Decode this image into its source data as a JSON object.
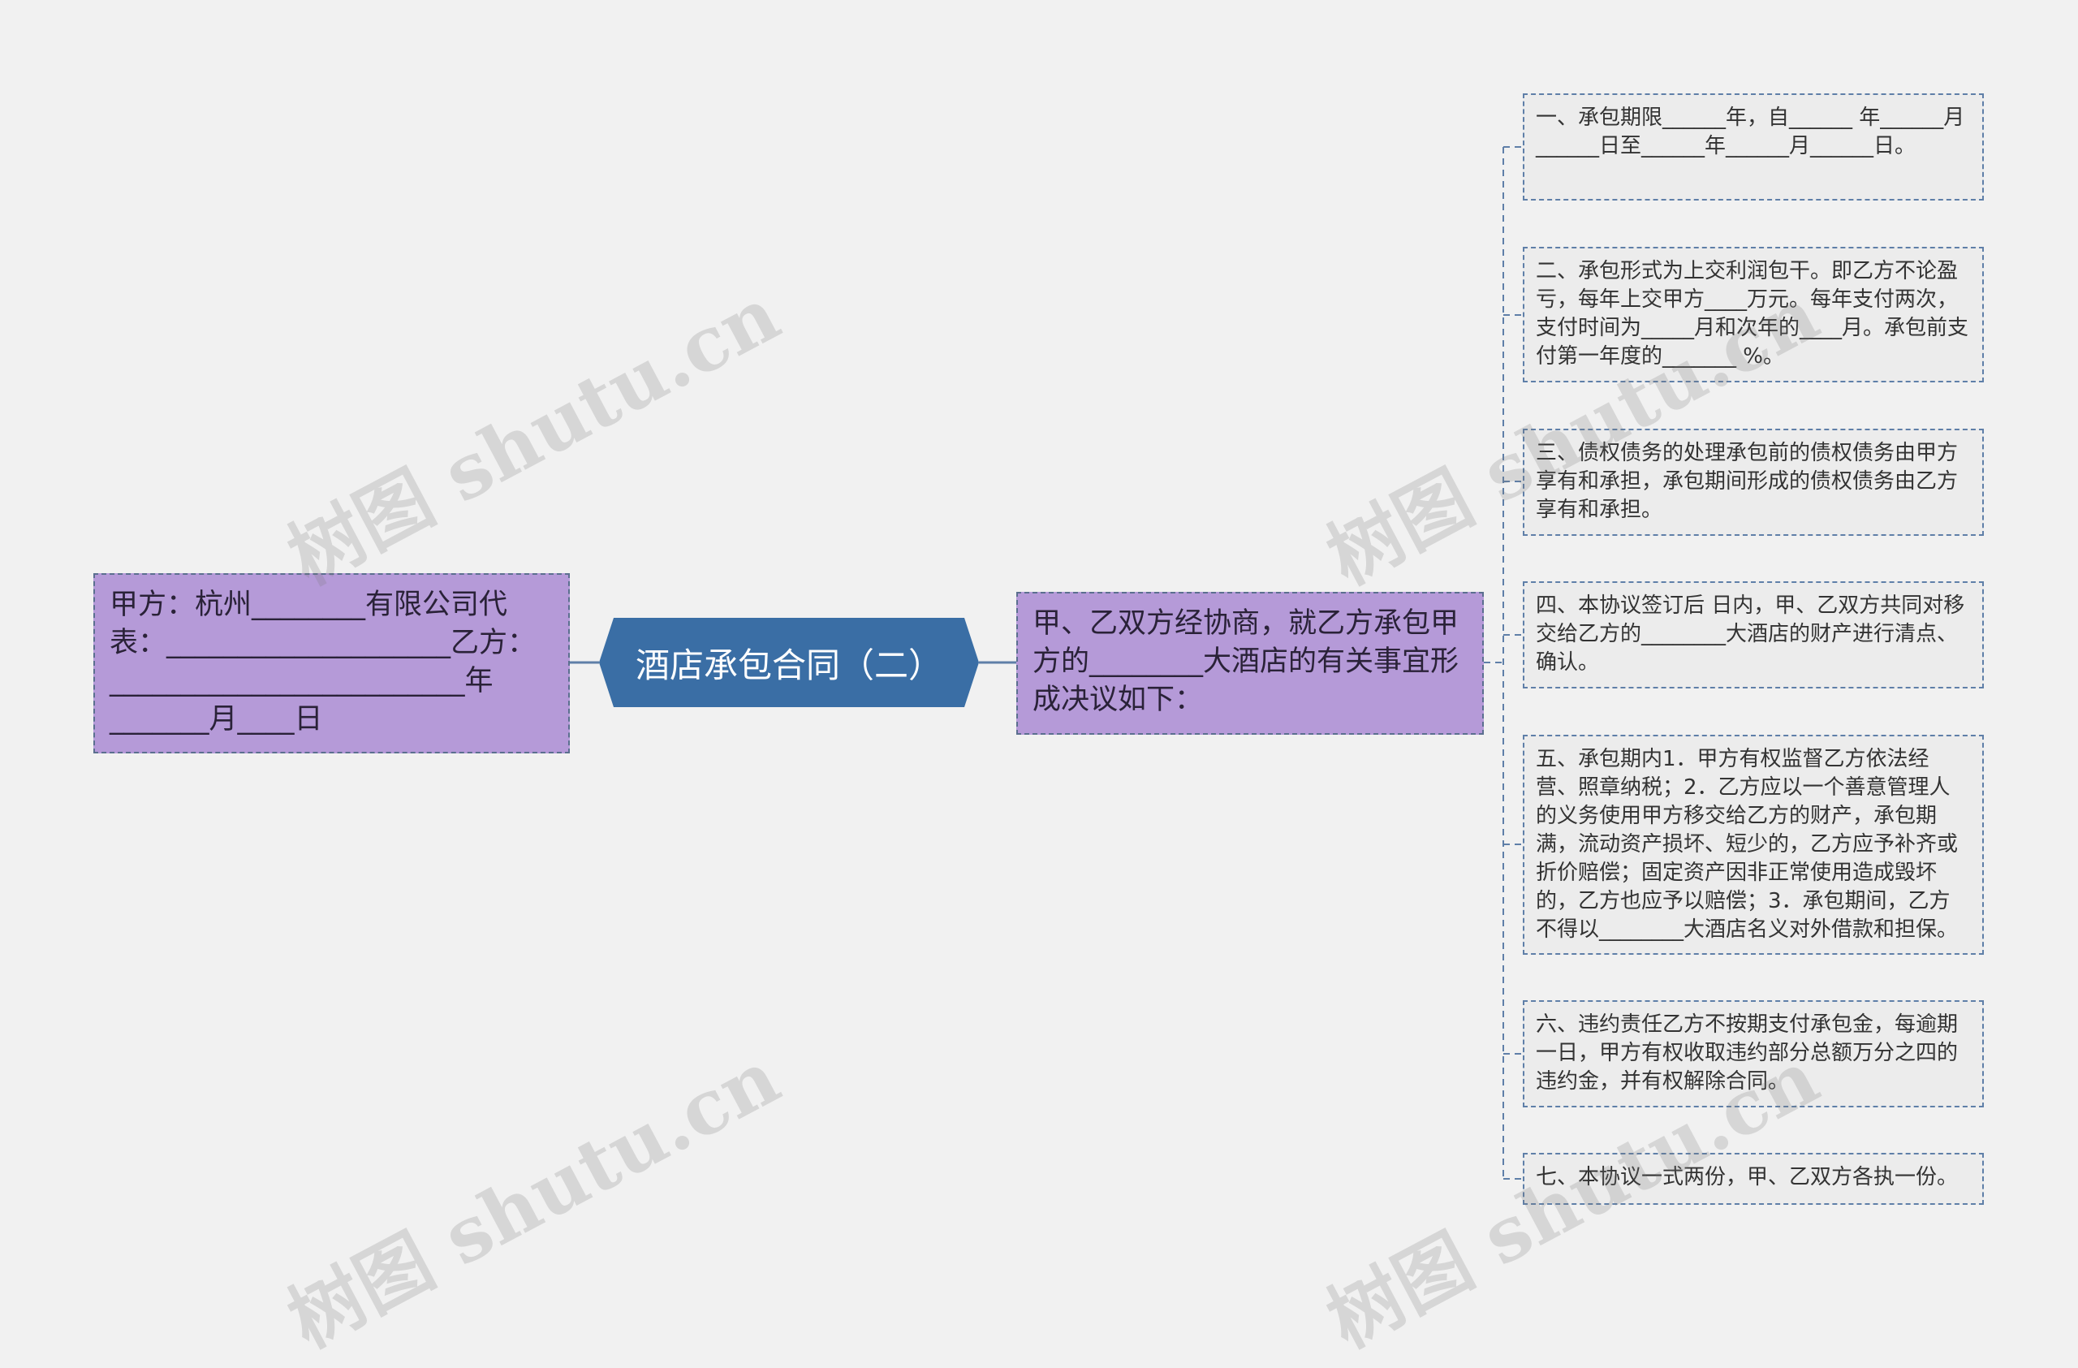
{
  "root": {
    "label": "酒店承包合同（二）"
  },
  "left_node": {
    "text": "甲方：杭州________有限公司代表：____________________乙方：_________________________年_______月____日"
  },
  "intro_node": {
    "text": "甲、乙双方经协商，就乙方承包甲方的________大酒店的有关事宜形成决议如下："
  },
  "clauses": [
    {
      "text": "一、承包期限______年，自______ 年______月______日至______年______月______日。"
    },
    {
      "text": "二、承包形式为上交利润包干。即乙方不论盈亏，每年上交甲方____万元。每年支付两次，支付时间为_____月和次年的____月。承包前支付第一年度的_______ %。"
    },
    {
      "text": "三、债权债务的处理承包前的债权债务由甲方享有和承担，承包期间形成的债权债务由乙方享有和承担。"
    },
    {
      "text": "四、本协议签订后 日内，甲、乙双方共同对移交给乙方的________大酒店的财产进行清点、确认。"
    },
    {
      "text": "五、承包期内1．甲方有权监督乙方依法经营、照章纳税；2．乙方应以一个善意管理人的义务使用甲方移交给乙方的财产，承包期满，流动资产损坏、短少的，乙方应予补齐或折价赔偿；固定资产因非正常使用造成毁坏的，乙方也应予以赔偿；3．承包期间，乙方不得以________大酒店名义对外借款和担保。"
    },
    {
      "text": "六、违约责任乙方不按期支付承包金，每逾期一日，甲方有权收取违约部分总额万分之四的违约金，并有权解除合同。"
    },
    {
      "text": "七、本协议一式两份，甲、乙双方各执一份。"
    }
  ],
  "watermark": {
    "text": "树图 shutu.cn"
  },
  "colors": {
    "background": "#f1f1f1",
    "root_fill": "#3a6ea5",
    "node_purple": "#b59ad8",
    "leaf_fill": "#ececec",
    "connector": "#5f7fa8"
  }
}
